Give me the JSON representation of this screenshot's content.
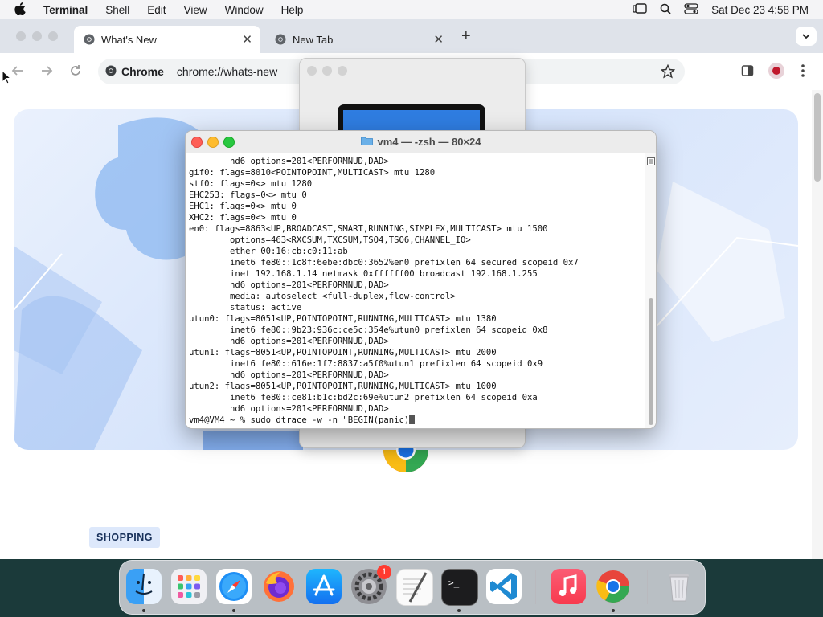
{
  "menubar": {
    "app_name": "Terminal",
    "items": [
      "Shell",
      "Edit",
      "View",
      "Window",
      "Help"
    ],
    "datetime": "Sat Dec 23  4:58 PM"
  },
  "chrome": {
    "tabs": [
      {
        "title": "What's New",
        "active": true
      },
      {
        "title": "New Tab",
        "active": false
      }
    ],
    "omnibox": {
      "chip": "Chrome",
      "url": "chrome://whats-new"
    },
    "content": {
      "badge": "SHOPPING"
    }
  },
  "terminal": {
    "title": "vm4 — -zsh — 80×24",
    "lines": [
      "        nd6 options=201<PERFORMNUD,DAD>",
      "gif0: flags=8010<POINTOPOINT,MULTICAST> mtu 1280",
      "stf0: flags=0<> mtu 1280",
      "EHC253: flags=0<> mtu 0",
      "EHC1: flags=0<> mtu 0",
      "XHC2: flags=0<> mtu 0",
      "en0: flags=8863<UP,BROADCAST,SMART,RUNNING,SIMPLEX,MULTICAST> mtu 1500",
      "        options=463<RXCSUM,TXCSUM,TSO4,TSO6,CHANNEL_IO>",
      "        ether 00:16:cb:c0:11:ab",
      "        inet6 fe80::1c8f:6ebe:dbc0:3652%en0 prefixlen 64 secured scopeid 0x7",
      "        inet 192.168.1.14 netmask 0xffffff00 broadcast 192.168.1.255",
      "        nd6 options=201<PERFORMNUD,DAD>",
      "        media: autoselect <full-duplex,flow-control>",
      "        status: active",
      "utun0: flags=8051<UP,POINTOPOINT,RUNNING,MULTICAST> mtu 1380",
      "        inet6 fe80::9b23:936c:ce5c:354e%utun0 prefixlen 64 scopeid 0x8",
      "        nd6 options=201<PERFORMNUD,DAD>",
      "utun1: flags=8051<UP,POINTOPOINT,RUNNING,MULTICAST> mtu 2000",
      "        inet6 fe80::616e:1f7:8837:a5f0%utun1 prefixlen 64 scopeid 0x9",
      "        nd6 options=201<PERFORMNUD,DAD>",
      "utun2: flags=8051<UP,POINTOPOINT,RUNNING,MULTICAST> mtu 1000",
      "        inet6 fe80::ce81:b1c:bd2c:69e%utun2 prefixlen 64 scopeid 0xa",
      "        nd6 options=201<PERFORMNUD,DAD>"
    ],
    "prompt": "vm4@VM4 ~ % sudo dtrace -w -n \"BEGIN(panic)"
  },
  "dock": {
    "apps": [
      "finder-icon",
      "launchpad-icon",
      "safari-icon",
      "firefox-icon",
      "app-store-icon",
      "system-settings-icon",
      "textedit-icon",
      "terminal-icon",
      "vscode-icon",
      "music-icon",
      "chrome-icon",
      "trash-icon"
    ],
    "settings_badge": "1"
  },
  "colors": {
    "accent": "#1a73e8",
    "close": "#fe5f57",
    "minimize": "#febc2e",
    "zoom": "#28c840"
  }
}
